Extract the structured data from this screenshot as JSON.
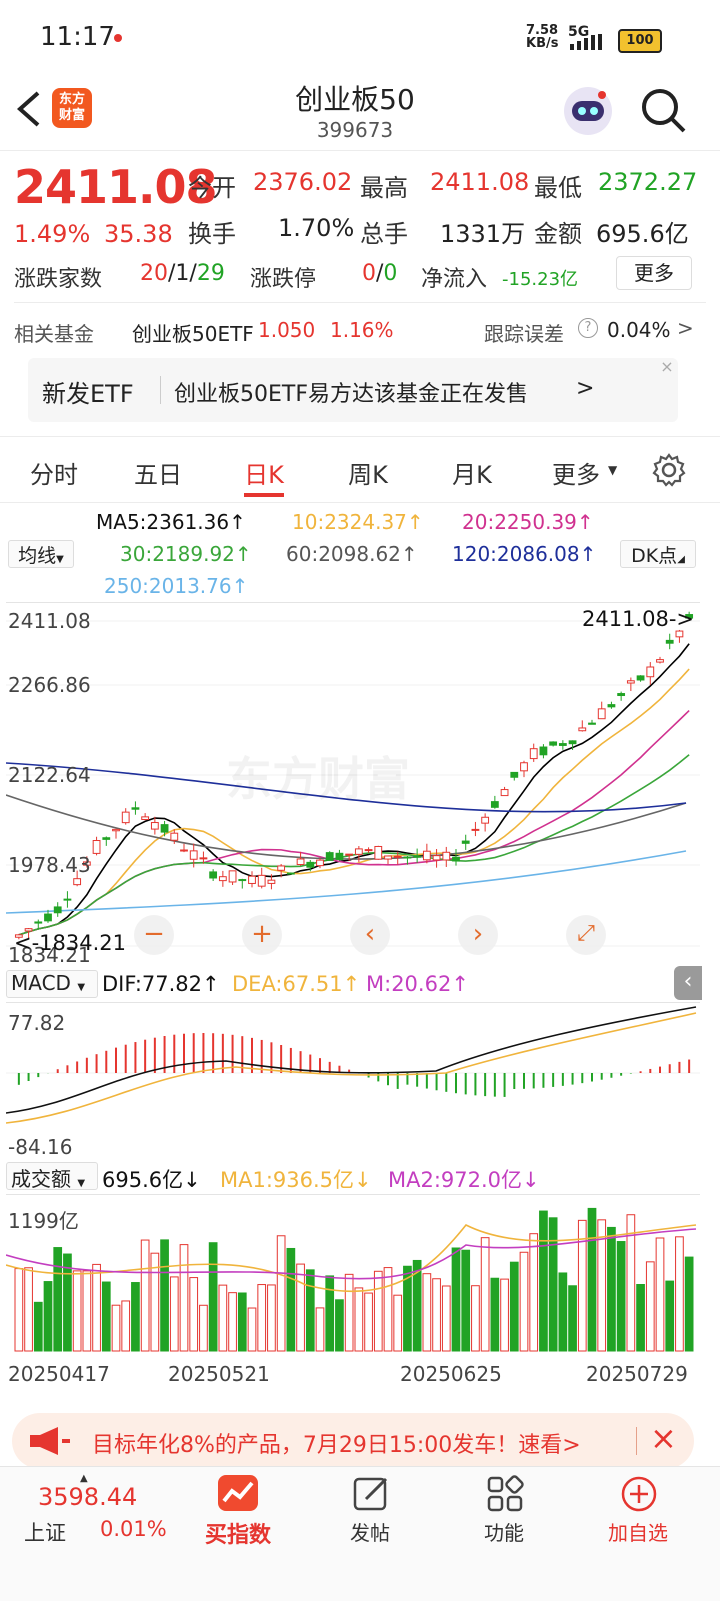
{
  "status_bar": {
    "time": "11:17",
    "speed": "7.58",
    "speed_unit": "KB/s",
    "network": "5G",
    "battery": "100"
  },
  "header": {
    "logo_text": "东方\n财富",
    "title": "创业板50",
    "code": "399673"
  },
  "quote": {
    "price": "2411.08",
    "change_pct": "1.49%",
    "change": "35.38",
    "open_label": "今开",
    "open": "2376.02",
    "high_label": "最高",
    "high": "2411.08",
    "low_label": "最低",
    "low": "2372.27",
    "turnover_label": "换手",
    "turnover": "1.70%",
    "volume_label": "总手",
    "volume": "1331万",
    "amount_label": "金额",
    "amount": "695.6亿",
    "breadth_label": "涨跌家数",
    "breadth_up": "20",
    "breadth_flat": "1",
    "breadth_down": "29",
    "limit_label": "涨跌停",
    "limit_up": "0",
    "limit_down": "0",
    "netflow_label": "净流入",
    "netflow": "-15.23亿",
    "more_button": "更多"
  },
  "fund": {
    "label": "相关基金",
    "name": "创业板50ETF",
    "price": "1.050",
    "pct": "1.16%",
    "err_label": "跟踪误差",
    "err_value": "0.04%",
    "chevron": ">"
  },
  "etf_banner": {
    "tag": "新发ETF",
    "text": "创业板50ETF易方达该基金正在发售",
    "chevron": ">",
    "close": "×"
  },
  "tabs": {
    "items": [
      "分时",
      "五日",
      "日K",
      "周K",
      "月K",
      "更多"
    ],
    "active": "日K"
  },
  "ma_legend": {
    "selector": "均线",
    "ma5": "MA5:2361.36↑",
    "ma10": "10:2324.37↑",
    "ma20": "20:2250.39↑",
    "ma30": "30:2189.92↑",
    "ma60": "60:2098.62↑",
    "ma120": "120:2086.08↑",
    "ma250": "250:2013.76↑",
    "dk_button": "DK点"
  },
  "kline": {
    "y_labels": [
      "2411.08",
      "2266.86",
      "2122.64",
      "1978.43",
      "1834.21"
    ],
    "max_marker": "2411.08->",
    "min_marker": "<-1834.21",
    "watermark": "东方财富"
  },
  "macd": {
    "selector": "MACD",
    "dif": "DIF:77.82↑",
    "dea": "DEA:67.51↑",
    "m": "M:20.62↑",
    "top": "77.82",
    "bottom": "-84.16"
  },
  "volume_panel": {
    "selector": "成交额",
    "value": "695.6亿↓",
    "ma1": "MA1:936.5亿↓",
    "ma2": "MA2:972.0亿↓",
    "top": "1199亿"
  },
  "dates": [
    "20250417",
    "20250521",
    "20250625",
    "20250729"
  ],
  "promo": {
    "text": "目标年化8%的产品，7月29日15:00发车！速看>",
    "close": "×"
  },
  "bottom_nav": {
    "index_value": "3598.44",
    "index_name": "上证",
    "index_pct": "0.01%",
    "items": [
      "买指数",
      "发帖",
      "功能",
      "加自选"
    ]
  },
  "colors": {
    "up": "#e5352f",
    "down": "#21a325",
    "accent": "#f2581f",
    "ma5": "#000000",
    "ma10": "#f0b43c",
    "ma20": "#d0318f",
    "ma30": "#3aa63a",
    "ma60": "#666666",
    "ma120": "#1e2f9a",
    "ma250": "#6ab4e8"
  }
}
